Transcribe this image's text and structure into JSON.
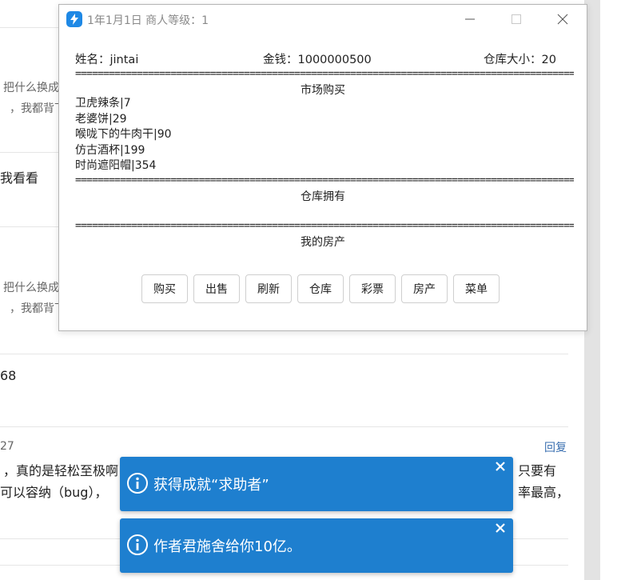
{
  "background": {
    "snippets": [
      {
        "id": "s1",
        "text": "把什么换成"
      },
      {
        "id": "s2",
        "text": "，我都背下"
      },
      {
        "id": "s3",
        "text": "我看看"
      },
      {
        "id": "s4",
        "text": "把什么换成"
      },
      {
        "id": "s5",
        "text": "，我都背下"
      },
      {
        "id": "s6",
        "text": "68"
      },
      {
        "id": "s7",
        "text": "27"
      },
      {
        "id": "s8",
        "text": "，真的是轻松至极啊"
      },
      {
        "id": "s9",
        "text": "只要有"
      },
      {
        "id": "s10",
        "text": "可以容纳（bug），"
      },
      {
        "id": "s11",
        "text": "率最高，"
      }
    ],
    "reply_label": "回复"
  },
  "window": {
    "title": "1年1月1日  商人等级：1",
    "info": {
      "name": "姓名：jintai",
      "money": "金钱：1000000500",
      "warehouse": "仓库大小：20"
    },
    "separator": "==============================================================================================",
    "sections": {
      "market": "市场购买",
      "warehouse": "仓库拥有",
      "property": "我的房产"
    },
    "market_items": [
      "卫虎辣条|7",
      "老婆饼|29",
      "喉咙下的牛肉干|90",
      "仿古酒杯|199",
      "时尚遮阳帽|354"
    ],
    "buttons": [
      "购买",
      "出售",
      "刷新",
      "仓库",
      "彩票",
      "房产",
      "菜单"
    ]
  },
  "toasts": [
    {
      "text": "获得成就“求助者”"
    },
    {
      "text": "作者君施舍给你10亿。"
    }
  ],
  "colors": {
    "toast_bg": "#1e7fcf",
    "app_icon": "#1e88e5",
    "reply_link": "#3a6fb0"
  }
}
